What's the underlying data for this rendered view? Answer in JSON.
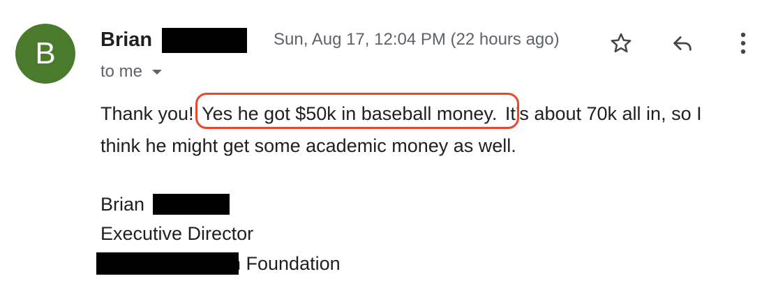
{
  "sender": {
    "avatar_letter": "B",
    "avatar_color": "#4a7a2c",
    "name": "Brian",
    "date": "Sun, Aug 17, 12:04 PM (22 hours ago)",
    "recipient": "to me"
  },
  "actions": {
    "star_icon": "star-icon",
    "reply_icon": "reply-icon",
    "more_icon": "more-vert-icon"
  },
  "body": {
    "line1_pre": "Thank you!",
    "line1_highlight": "Yes he got $50k in baseball money.",
    "line1_post": "It’s about 70k all in, so I",
    "line2": "think he might get some academic money as well.",
    "highlight_color": "#e8472c"
  },
  "signature": {
    "name": "Brian",
    "title": "Executive Director",
    "org_suffix": "n Foundation"
  }
}
